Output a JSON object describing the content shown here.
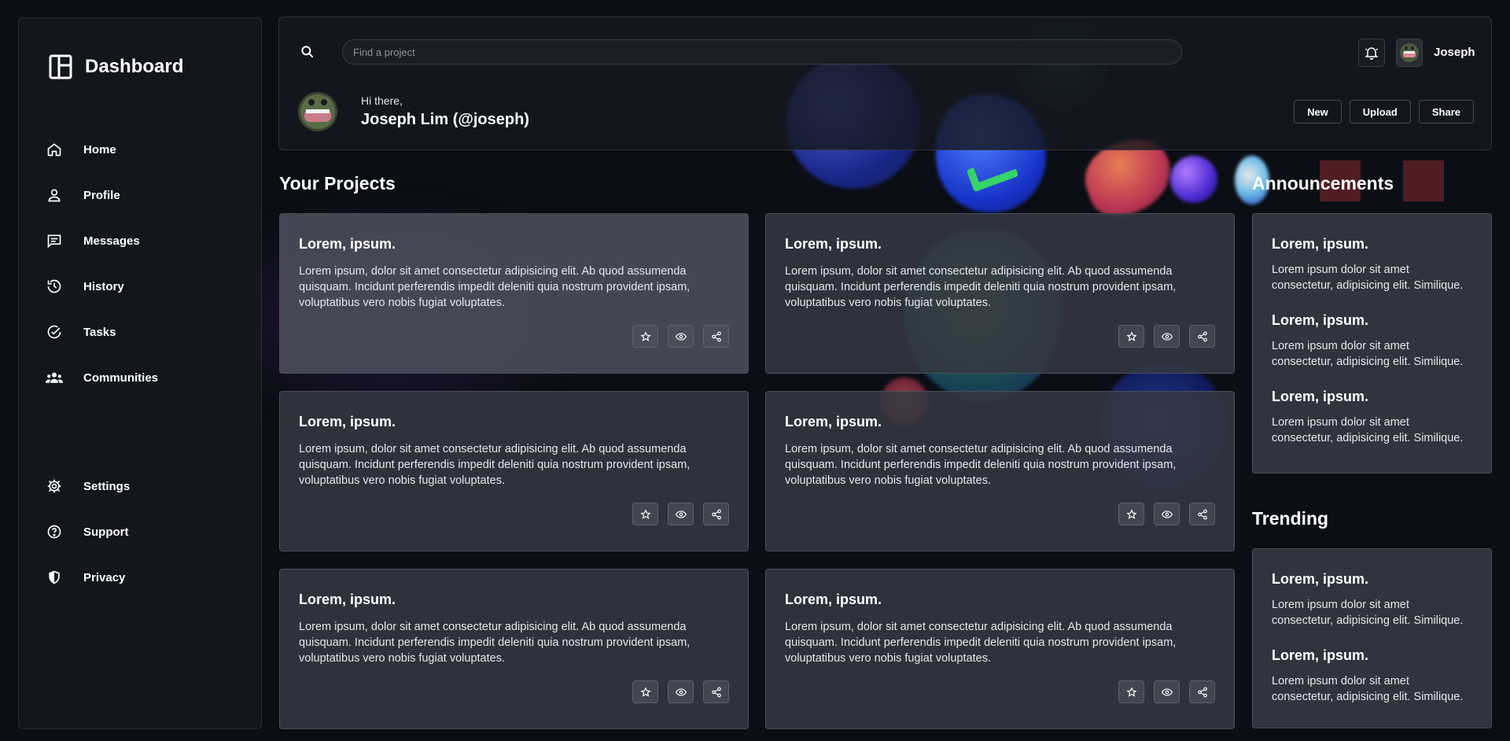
{
  "sidebar": {
    "brand": "Dashboard",
    "nav": [
      {
        "label": "Home",
        "icon": "home-icon"
      },
      {
        "label": "Profile",
        "icon": "user-icon"
      },
      {
        "label": "Messages",
        "icon": "message-icon"
      },
      {
        "label": "History",
        "icon": "history-icon"
      },
      {
        "label": "Tasks",
        "icon": "check-circle-icon"
      },
      {
        "label": "Communities",
        "icon": "group-icon"
      }
    ],
    "nav_bottom": [
      {
        "label": "Settings",
        "icon": "gear-icon"
      },
      {
        "label": "Support",
        "icon": "question-circle-icon"
      },
      {
        "label": "Privacy",
        "icon": "shield-icon"
      }
    ]
  },
  "header": {
    "search_placeholder": "Find a project",
    "username": "Joseph",
    "greeting": "Hi there,",
    "fullname": "Joseph Lim (@joseph)",
    "actions": [
      "New",
      "Upload",
      "Share"
    ]
  },
  "projects": {
    "title": "Your Projects",
    "items": [
      {
        "title": "Lorem, ipsum.",
        "body": "Lorem ipsum, dolor sit amet consectetur adipisicing elit. Ab quod assumenda quisquam. Incidunt perferendis impedit deleniti quia nostrum provident ipsam, voluptatibus vero nobis fugiat voluptates."
      },
      {
        "title": "Lorem, ipsum.",
        "body": "Lorem ipsum, dolor sit amet consectetur adipisicing elit. Ab quod assumenda quisquam. Incidunt perferendis impedit deleniti quia nostrum provident ipsam, voluptatibus vero nobis fugiat voluptates."
      },
      {
        "title": "Lorem, ipsum.",
        "body": "Lorem ipsum, dolor sit amet consectetur adipisicing elit. Ab quod assumenda quisquam. Incidunt perferendis impedit deleniti quia nostrum provident ipsam, voluptatibus vero nobis fugiat voluptates."
      },
      {
        "title": "Lorem, ipsum.",
        "body": "Lorem ipsum, dolor sit amet consectetur adipisicing elit. Ab quod assumenda quisquam. Incidunt perferendis impedit deleniti quia nostrum provident ipsam, voluptatibus vero nobis fugiat voluptates."
      },
      {
        "title": "Lorem, ipsum.",
        "body": "Lorem ipsum, dolor sit amet consectetur adipisicing elit. Ab quod assumenda quisquam. Incidunt perferendis impedit deleniti quia nostrum provident ipsam, voluptatibus vero nobis fugiat voluptates."
      },
      {
        "title": "Lorem, ipsum.",
        "body": "Lorem ipsum, dolor sit amet consectetur adipisicing elit. Ab quod assumenda quisquam. Incidunt perferendis impedit deleniti quia nostrum provident ipsam, voluptatibus vero nobis fugiat voluptates."
      }
    ],
    "card_action_icons": [
      "star-icon",
      "eye-icon",
      "share-icon"
    ]
  },
  "announcements": {
    "title": "Announcements",
    "items": [
      {
        "title": "Lorem, ipsum.",
        "body": "Lorem ipsum dolor sit amet consectetur, adipisicing elit. Similique."
      },
      {
        "title": "Lorem, ipsum.",
        "body": "Lorem ipsum dolor sit amet consectetur, adipisicing elit. Similique."
      },
      {
        "title": "Lorem, ipsum.",
        "body": "Lorem ipsum dolor sit amet consectetur, adipisicing elit. Similique."
      }
    ]
  },
  "trending": {
    "title": "Trending",
    "items": [
      {
        "title": "Lorem, ipsum.",
        "body": "Lorem ipsum dolor sit amet consectetur, adipisicing elit. Similique."
      },
      {
        "title": "Lorem, ipsum.",
        "body": "Lorem ipsum dolor sit amet consectetur, adipisicing elit. Similique."
      }
    ]
  },
  "colors": {
    "background": "#0b0e14",
    "sidebar": "#14171e",
    "card": "#343842",
    "text": "#ffffff"
  }
}
